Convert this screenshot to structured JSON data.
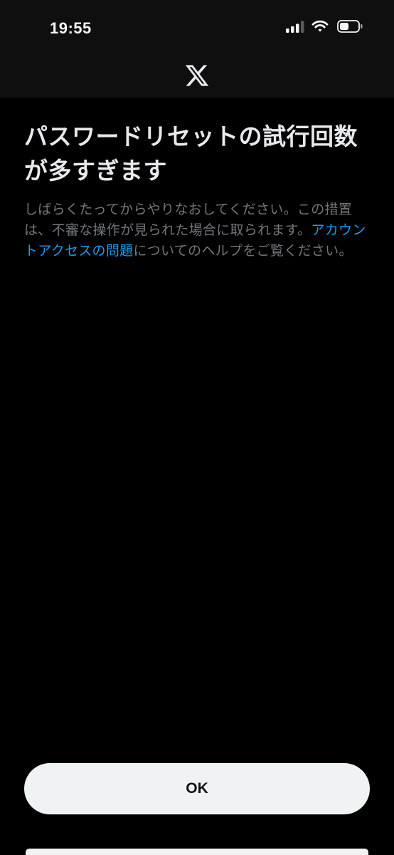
{
  "status_bar": {
    "time": "19:55",
    "icons": [
      "cellular-signal-icon",
      "wifi-icon",
      "battery-icon"
    ]
  },
  "nav": {
    "logo": "x-logo-icon"
  },
  "dialog": {
    "title": "パスワードリセットの試行回数が多すぎます",
    "description_before_link": "しばらくたってからやりなおしてください。この措置は、不審な操作が見られた場合に取られます。",
    "link_text": "アカウントアクセスの問題",
    "description_after_link": "についてのヘルプをご覧ください。"
  },
  "ok_button": {
    "label": "OK"
  },
  "colors": {
    "background": "#000000",
    "header_background": "#0f0f0f",
    "title_text": "#e7e9ea",
    "secondary_text": "#71767b",
    "link": "#1d9bf0",
    "button_background": "#eff3f4",
    "button_text": "#0f1419"
  }
}
